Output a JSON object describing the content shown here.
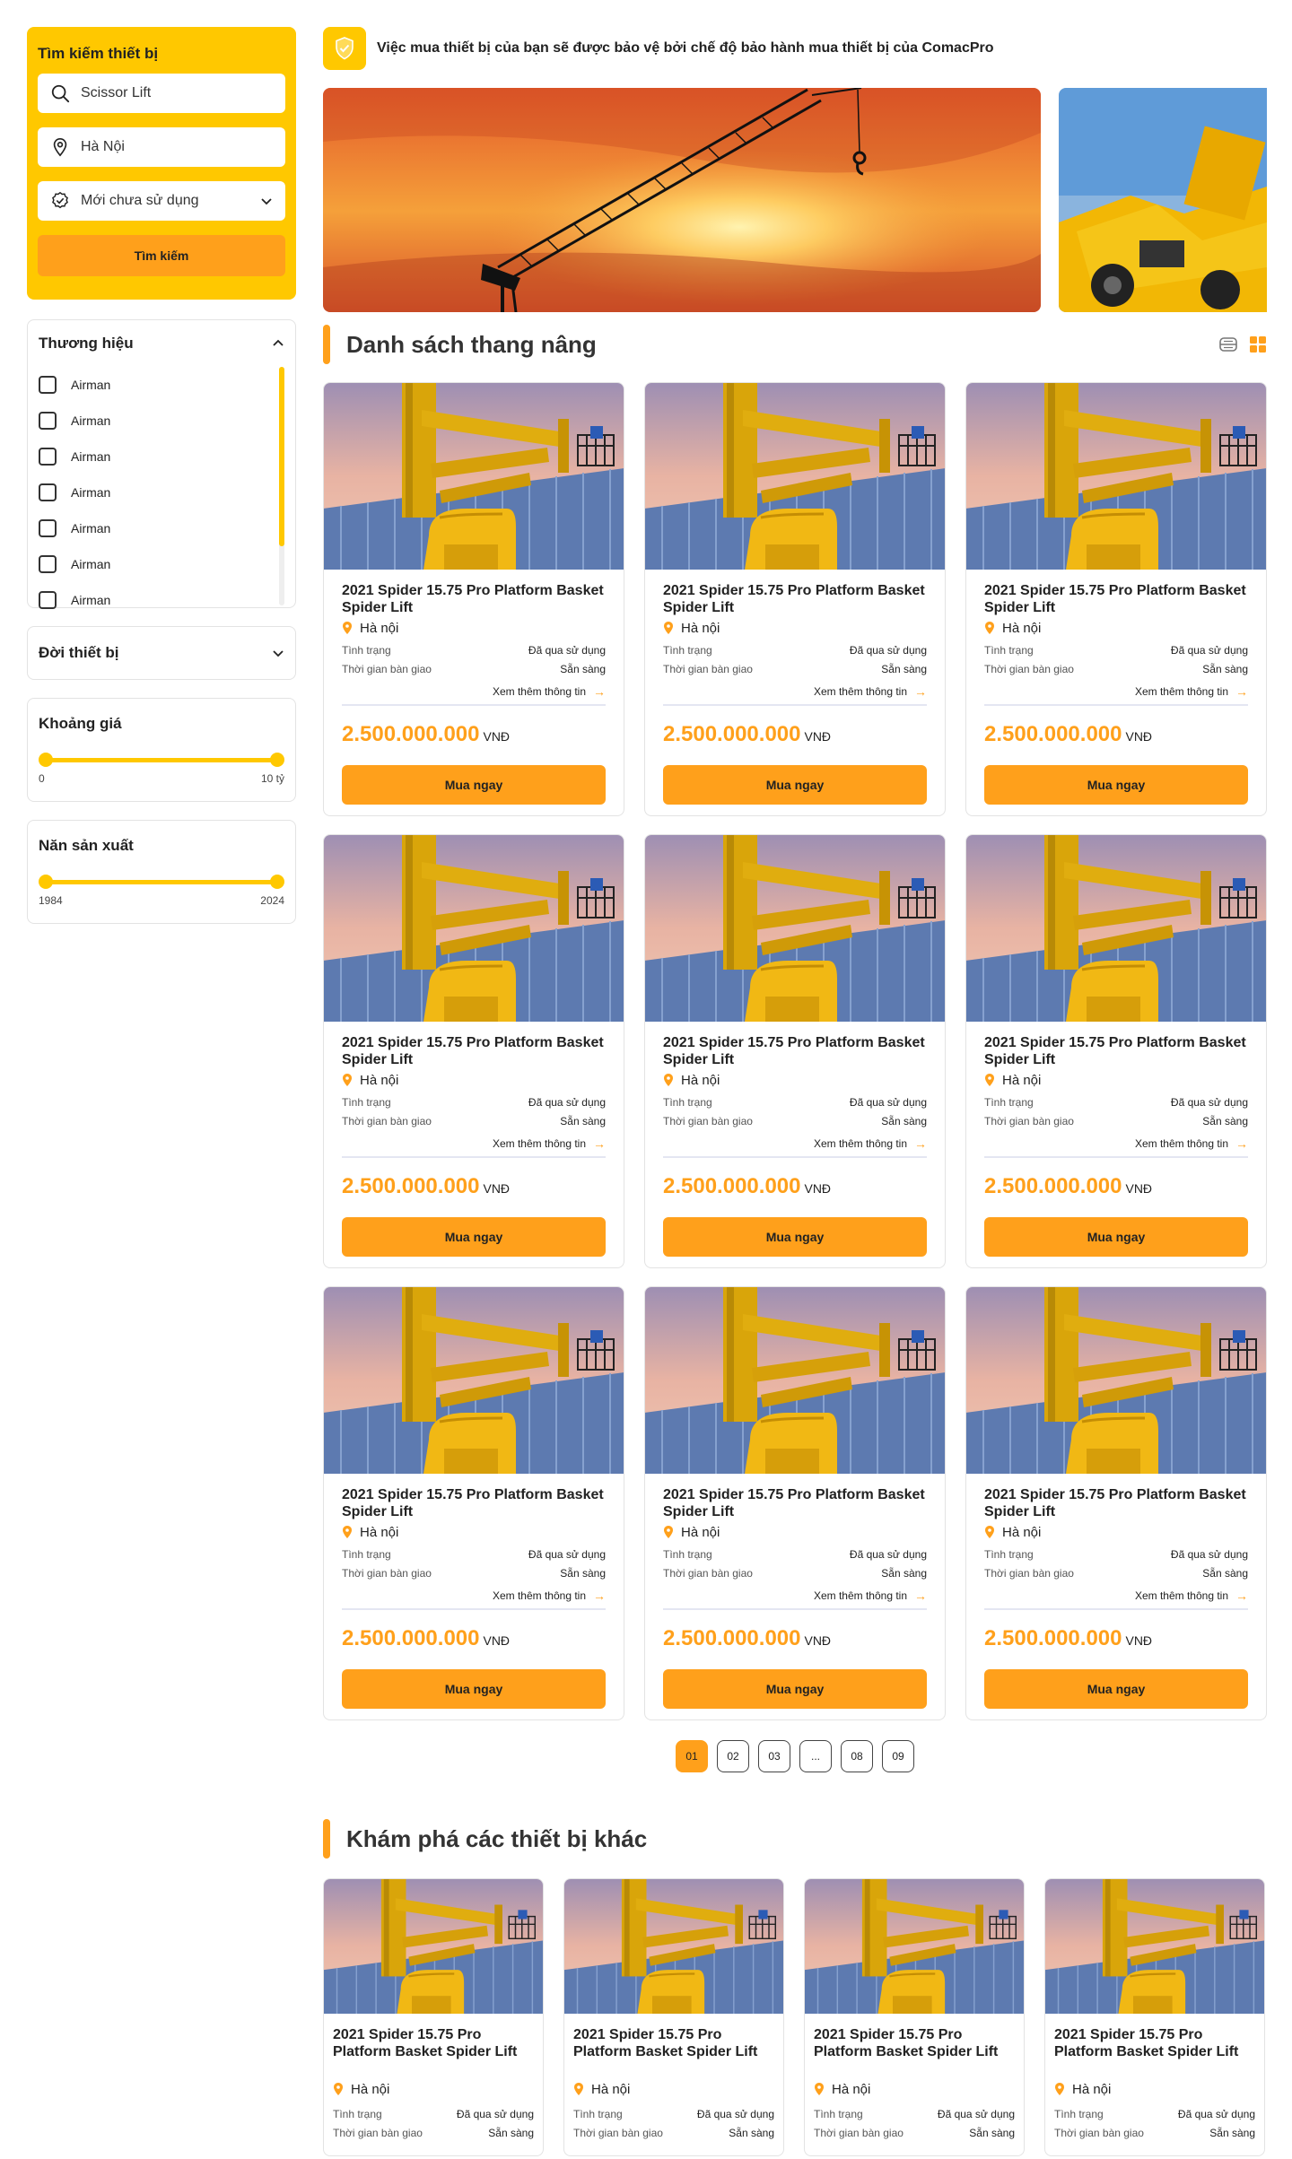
{
  "search": {
    "title": "Tìm kiếm thiết bị",
    "keyword": "Scissor Lift",
    "location": "Hà Nội",
    "condition": "Mới chưa sử dụng",
    "button": "Tìm kiếm"
  },
  "brand_filter": {
    "title": "Thương hiệu",
    "items": [
      "Airman",
      "Airman",
      "Airman",
      "Airman",
      "Airman",
      "Airman",
      "Airman"
    ]
  },
  "year_filter": {
    "title": "Đời thiết bị"
  },
  "price_filter": {
    "title": "Khoảng giá",
    "min_label": "0",
    "max_label": "10 tỷ"
  },
  "manufacture_filter": {
    "title": "Năn sản xuất",
    "min_label": "1984",
    "max_label": "2024"
  },
  "notice": "Việc mua thiết bị của bạn sẽ được bảo vệ bởi chế độ bảo hành mua thiết bị của ComacPro",
  "list_section": {
    "title": "Danh sách thang nâng"
  },
  "product": {
    "title": "2021 Spider 15.75 Pro Platform Basket Spider Lift",
    "location": "Hà nội",
    "status_label": "Tình trạng",
    "status_value": "Đã qua sử dụng",
    "delivery_label": "Thời gian bàn giao",
    "delivery_value": "Sẵn sàng",
    "more": "Xem thêm thông tin",
    "price": "2.500.000.000",
    "currency": "VNĐ",
    "buy": "Mua ngay"
  },
  "pagination": [
    "01",
    "02",
    "03",
    "...",
    "08",
    "09"
  ],
  "explore_section": {
    "title": "Khám phá các thiết bị khác"
  },
  "colors": {
    "primary_yellow": "#FFC800",
    "accent_orange": "#FFA01B"
  }
}
